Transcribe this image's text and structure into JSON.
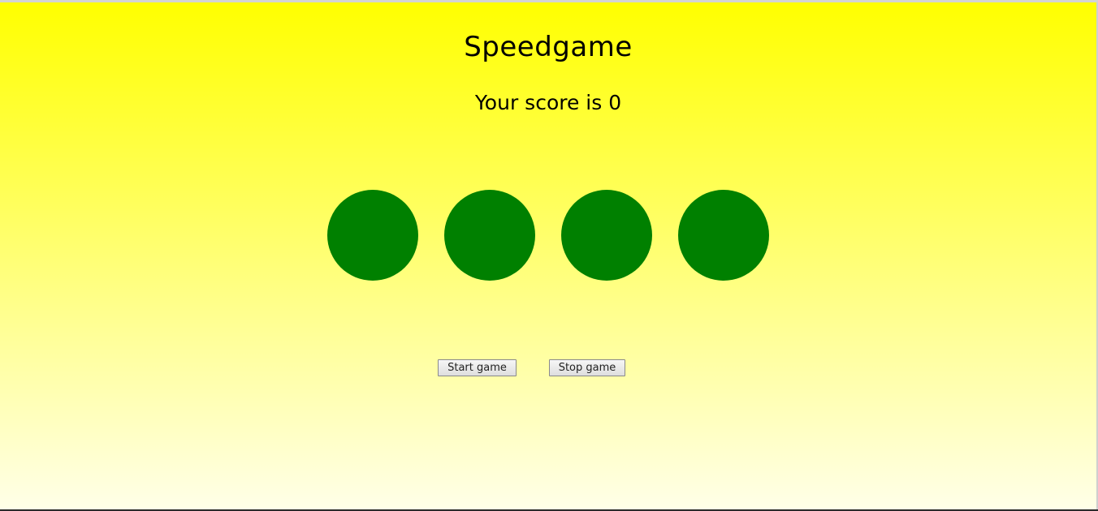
{
  "game": {
    "title": "Speedgame",
    "score_text": "Your score is 0",
    "score": 0
  },
  "circles": [
    {
      "id": 1,
      "color": "#008000"
    },
    {
      "id": 2,
      "color": "#008000"
    },
    {
      "id": 3,
      "color": "#008000"
    },
    {
      "id": 4,
      "color": "#008000"
    }
  ],
  "controls": {
    "start_label": "Start game",
    "stop_label": "Stop game"
  },
  "theme": {
    "background_top": "#ffff00",
    "background_bottom": "#ffffe8",
    "circle_color": "#008000"
  }
}
